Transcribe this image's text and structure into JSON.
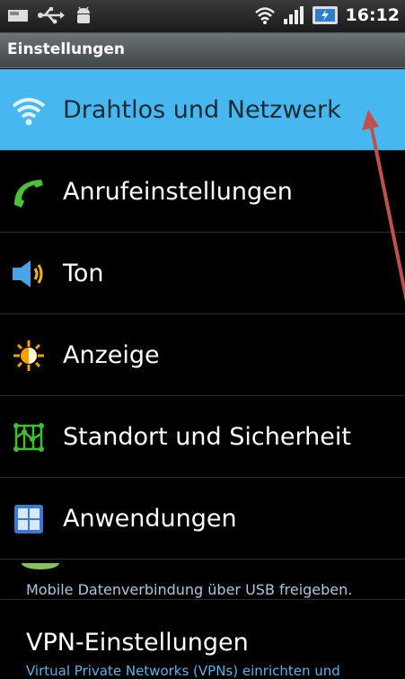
{
  "status_bar": {
    "time": "16:12",
    "icons": [
      "sd-card-icon",
      "usb-icon",
      "android-debug-icon",
      "wifi-icon",
      "signal-icon",
      "battery-charging-icon"
    ]
  },
  "title_bar": {
    "title": "Einstellungen"
  },
  "settings": {
    "items": [
      {
        "label": "Drahtlos und Netzwerk",
        "icon": "wifi-icon",
        "selected": true
      },
      {
        "label": "Anrufeinstellungen",
        "icon": "phone-handset-icon"
      },
      {
        "label": "Ton",
        "icon": "speaker-icon"
      },
      {
        "label": "Anzeige",
        "icon": "brightness-icon"
      },
      {
        "label": "Standort und Sicherheit",
        "icon": "location-grid-icon"
      },
      {
        "label": "Anwendungen",
        "icon": "applications-icon"
      }
    ],
    "partial_item": {
      "subtitle": "Mobile Datenverbindung über USB freigeben."
    },
    "vpn": {
      "title": "VPN-Einstellungen",
      "subtitle": "Virtual Private Networks (VPNs) einrichten und"
    }
  },
  "colors": {
    "selected": "#47b8ef",
    "subtitle": "#57b3e8",
    "annotation_arrow": "#c0504d"
  }
}
